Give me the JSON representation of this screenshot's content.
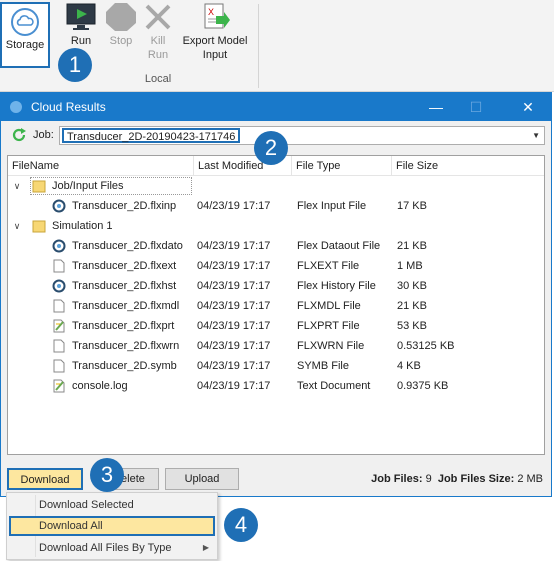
{
  "ribbon": {
    "storage_label": "Storage",
    "run_label": "Run",
    "stop_label": "Stop",
    "kill_label": "Kill\nRun",
    "export_label": "Export Model\nInput",
    "group_label": "Local"
  },
  "callouts": [
    "1",
    "2",
    "3",
    "4"
  ],
  "dialog": {
    "title": "Cloud Results",
    "job_label": "Job:",
    "job_value": "Transducer_2D-20190423-171746",
    "columns": [
      "FileName",
      "Last Modified",
      "File Type",
      "File Size"
    ],
    "folders": [
      {
        "name": "Job/Input Files",
        "files": [
          {
            "name": "Transducer_2D.flxinp",
            "modified": "04/23/19 17:17",
            "type": "Flex Input File",
            "size": "17 KB",
            "icon": "flex-file-icon"
          }
        ]
      },
      {
        "name": "Simulation 1",
        "files": [
          {
            "name": "Transducer_2D.flxdato",
            "modified": "04/23/19 17:17",
            "type": "Flex Dataout File",
            "size": "21 KB",
            "icon": "flex-file-icon"
          },
          {
            "name": "Transducer_2D.flxext",
            "modified": "04/23/19 17:17",
            "type": "FLXEXT File",
            "size": "1 MB",
            "icon": "blank-file-icon"
          },
          {
            "name": "Transducer_2D.flxhst",
            "modified": "04/23/19 17:17",
            "type": "Flex History File",
            "size": "30 KB",
            "icon": "flex-file-icon"
          },
          {
            "name": "Transducer_2D.flxmdl",
            "modified": "04/23/19 17:17",
            "type": "FLXMDL File",
            "size": "21 KB",
            "icon": "blank-file-icon"
          },
          {
            "name": "Transducer_2D.flxprt",
            "modified": "04/23/19 17:17",
            "type": "FLXPRT File",
            "size": "53 KB",
            "icon": "edit-file-icon"
          },
          {
            "name": "Transducer_2D.flxwrn",
            "modified": "04/23/19 17:17",
            "type": "FLXWRN File",
            "size": "0.53125 KB",
            "icon": "blank-file-icon"
          },
          {
            "name": "Transducer_2D.symb",
            "modified": "04/23/19 17:17",
            "type": "SYMB File",
            "size": "4 KB",
            "icon": "blank-file-icon"
          },
          {
            "name": "console.log",
            "modified": "04/23/19 17:17",
            "type": "Text Document",
            "size": "0.9375 KB",
            "icon": "edit-file-icon"
          }
        ]
      }
    ],
    "buttons": {
      "download": "Download",
      "delete": "Delete",
      "upload": "Upload"
    },
    "stats": {
      "job_files_label": "Job Files:",
      "job_files_value": "9",
      "size_label": "Job Files Size:",
      "size_value": "2 MB"
    }
  },
  "download_menu": {
    "items": [
      "Download Selected",
      "Download All",
      "Download All Files By Type"
    ]
  },
  "colors": {
    "accent": "#1979ca",
    "callout": "#1f6fb5",
    "highlight": "#fde79f"
  }
}
